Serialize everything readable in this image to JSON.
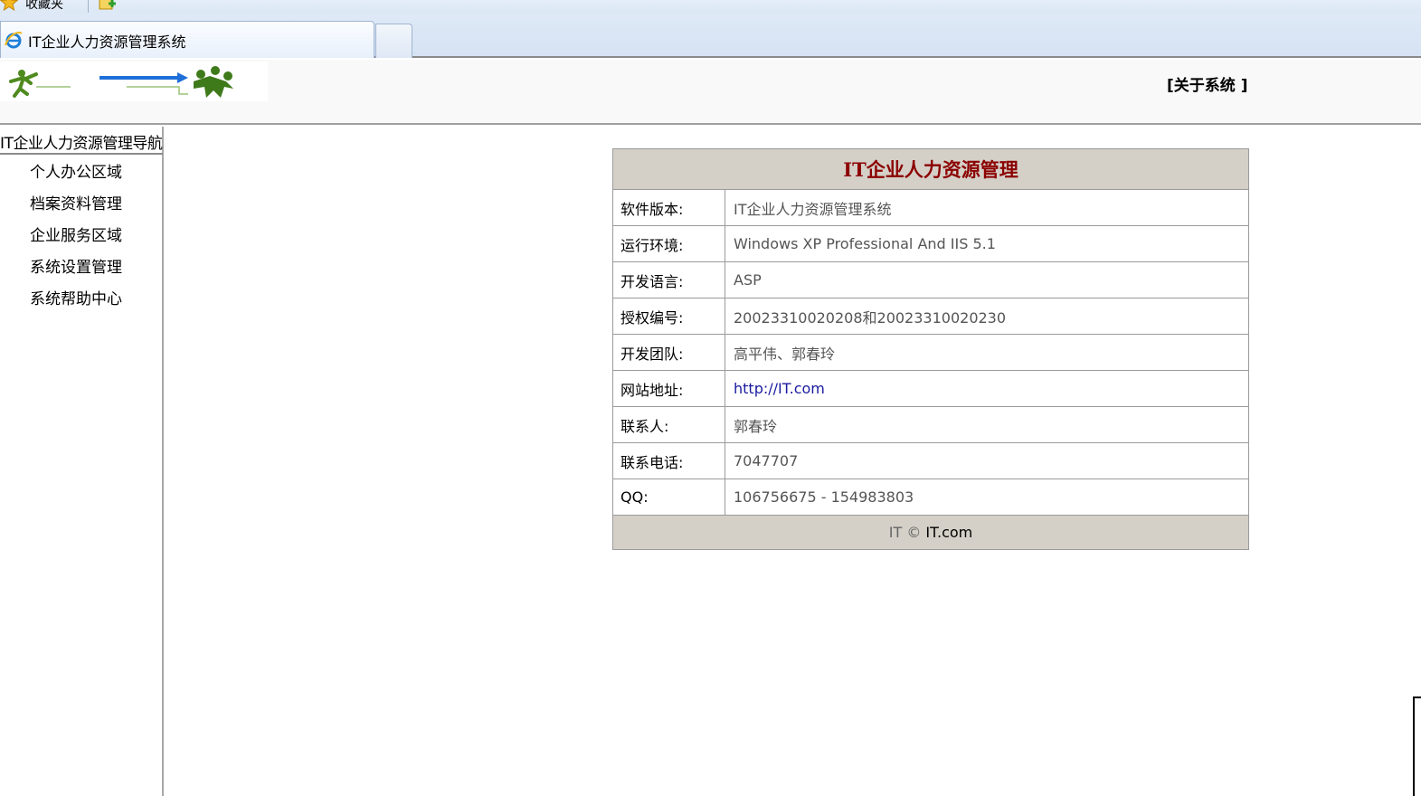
{
  "browser": {
    "favorites_label": "收藏夹",
    "tab_title": "IT企业人力资源管理系统"
  },
  "header": {
    "about_link": "[关于系统 ]"
  },
  "sidebar": {
    "title": "IT企业人力资源管理导航",
    "items": [
      {
        "label": "个人办公区域"
      },
      {
        "label": "档案资料管理"
      },
      {
        "label": "企业服务区域"
      },
      {
        "label": "系统设置管理"
      },
      {
        "label": "系统帮助中心"
      }
    ]
  },
  "info": {
    "title": "IT企业人力资源管理",
    "rows": [
      {
        "label": "软件版本:",
        "value": "IT企业人力资源管理系统"
      },
      {
        "label": "运行环境:",
        "value": "Windows XP Professional And IIS 5.1"
      },
      {
        "label": "开发语言:",
        "value": "ASP"
      },
      {
        "label": "授权编号:",
        "value": "20023310020208和20023310020230"
      },
      {
        "label": "开发团队:",
        "value": "高平伟、郭春玲"
      },
      {
        "label": "网站地址:",
        "value": "http://IT.com"
      },
      {
        "label": "联系人:",
        "value": "郭春玲"
      },
      {
        "label": "联系电话:",
        "value": "7047707"
      },
      {
        "label": "QQ:",
        "value": "106756675 - 154983803"
      }
    ],
    "footer_prefix": "IT © ",
    "footer_brand": "IT.com"
  },
  "colors": {
    "title_red": "#8b0000",
    "table_header_bg": "#d4d0c8",
    "link_blue": "#1a1aa0"
  }
}
